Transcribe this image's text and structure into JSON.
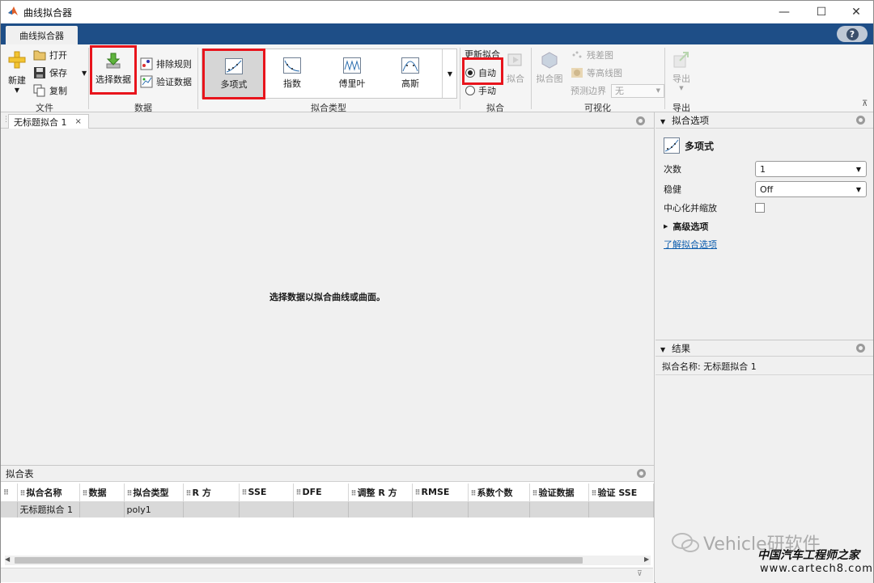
{
  "window": {
    "title": "曲线拟合器",
    "minimize": "—",
    "maximize": "☐",
    "close": "✕"
  },
  "ribbon": {
    "tab_label": "曲线拟合器",
    "help": "?",
    "file": {
      "group_label": "文件",
      "new_label": "新建",
      "open_label": "打开",
      "save_label": "保存",
      "copy_label": "复制"
    },
    "data": {
      "group_label": "数据",
      "select_data_label": "选择数据",
      "exclusion_rules_label": "排除规则",
      "validation_data_label": "验证数据"
    },
    "fit_type": {
      "group_label": "拟合类型",
      "items": [
        "多项式",
        "指数",
        "傅里叶",
        "高斯"
      ],
      "selected": "多项式"
    },
    "fit": {
      "group_label": "拟合",
      "update_label": "更新拟合",
      "auto_label": "自动",
      "manual_label": "手动",
      "fit_button_label": "拟合",
      "auto_selected": true
    },
    "visualize": {
      "group_label": "可视化",
      "fit_plot_label": "拟合图",
      "residuals_label": "残差图",
      "contour_label": "等高线图",
      "prediction_bounds_label": "预测边界",
      "prediction_bounds_value": "无"
    },
    "export": {
      "group_label": "导出",
      "export_label": "导出"
    }
  },
  "document": {
    "tab_label": "无标题拟合 1",
    "center_message": "选择数据以拟合曲线或曲面。"
  },
  "fit_table": {
    "title": "拟合表",
    "columns": [
      "拟合名称",
      "数据",
      "拟合类型",
      "R 方",
      "SSE",
      "DFE",
      "调整 R 方",
      "RMSE",
      "系数个数",
      "验证数据",
      "验证 SSE"
    ],
    "rows": [
      [
        "无标题拟合 1",
        "",
        "poly1",
        "",
        "",
        "",
        "",
        "",
        "",
        "",
        ""
      ]
    ]
  },
  "fit_options": {
    "title": "拟合选项",
    "model_name": "多项式",
    "degree_label": "次数",
    "degree_value": "1",
    "robust_label": "稳健",
    "robust_value": "Off",
    "center_scale_label": "中心化并缩放",
    "center_scale_checked": false,
    "advanced_label": "高级选项",
    "learn_more_link": "了解拟合选项"
  },
  "results": {
    "title": "结果",
    "fit_name_text": "拟合名称: 无标题拟合 1"
  },
  "watermark": {
    "line1": "Vehicle研软件",
    "line2": "中国汽车工程师之家",
    "line3": "www.cartech8.com"
  },
  "colors": {
    "ribbon_blue": "#1e4e87",
    "highlight_red": "#e8141c",
    "link_blue": "#0b5cad"
  }
}
